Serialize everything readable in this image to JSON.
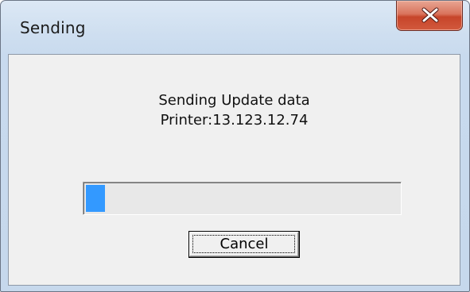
{
  "window": {
    "title": "Sending"
  },
  "icons": {
    "close": "close-icon"
  },
  "dialog": {
    "message_line1": "Sending Update data",
    "message_line2": "Printer:13.123.12.74",
    "progress_fraction": 0.06,
    "cancel_label": "Cancel"
  },
  "colors": {
    "progress_fill": "#3399ff",
    "close_button": "#c7452a"
  }
}
